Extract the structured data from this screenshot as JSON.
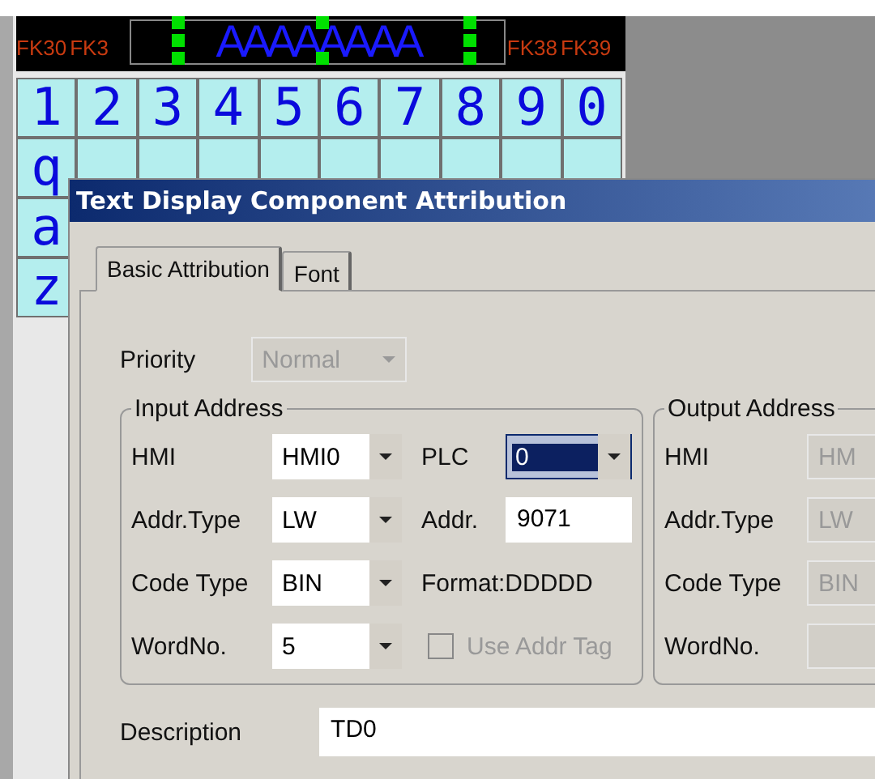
{
  "canvas": {
    "strip_labels": [
      "FK30",
      "FK3",
      "FK38",
      "FK39"
    ],
    "selected_text": "AAAAAAAA",
    "number_keys": [
      "1",
      "2",
      "3",
      "4",
      "5",
      "6",
      "7",
      "8",
      "9",
      "0"
    ],
    "letter_keys": [
      "q",
      "a",
      "z"
    ]
  },
  "dialog": {
    "title": "Text Display Component Attribution",
    "tabs": [
      {
        "label": "Basic Attribution",
        "selected": true
      },
      {
        "label": "Font",
        "selected": false
      }
    ],
    "priority": {
      "label": "Priority",
      "value": "Normal",
      "disabled": true
    },
    "input_address": {
      "title": "Input Address",
      "rows": [
        {
          "label": "HMI",
          "value": "HMI0",
          "label2": "PLC",
          "value2": "0",
          "kind": "combo",
          "focused2": true
        },
        {
          "label": "Addr.Type",
          "value": "LW",
          "label2": "Addr.",
          "value2": "9071",
          "kind": "field",
          "focused2": false
        },
        {
          "label": "Code Type",
          "value": "BIN",
          "label2": "Format:DDDDD",
          "kind": "text"
        },
        {
          "label": "WordNo.",
          "value": "5",
          "label2": "Use Addr Tag",
          "kind": "checkbox",
          "checked2": false,
          "disabled2": true
        }
      ]
    },
    "output_address": {
      "title": "Output Address",
      "rows": [
        {
          "label": "HMI",
          "value": "HM",
          "disabled": true
        },
        {
          "label": "Addr.Type",
          "value": "LW",
          "disabled": true
        },
        {
          "label": "Code Type",
          "value": "BIN",
          "disabled": true
        },
        {
          "label": "WordNo.",
          "value": "",
          "disabled": true
        }
      ]
    },
    "description": {
      "label": "Description",
      "value": "TD0"
    }
  }
}
